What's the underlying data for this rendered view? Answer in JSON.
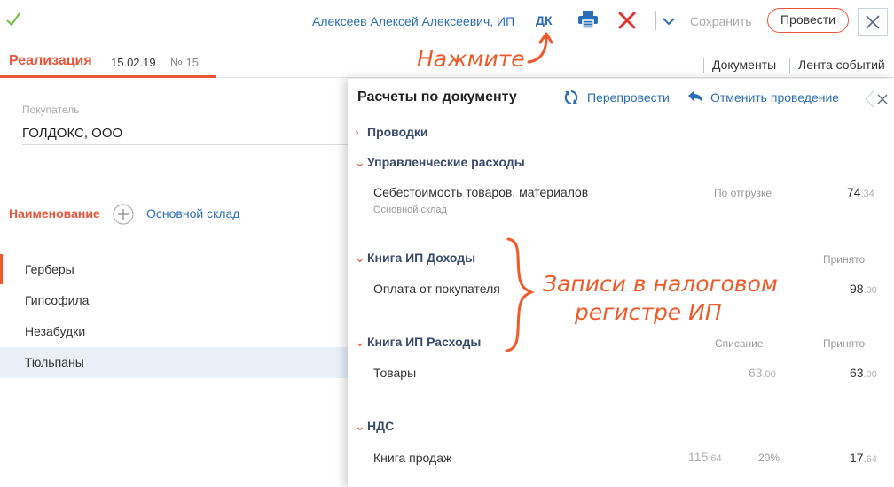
{
  "toolbar": {
    "user": "Алексеев Алексей Алексеевич, ИП",
    "dk": "ДК",
    "save": "Сохранить",
    "post": "Провести"
  },
  "document": {
    "title": "Реализация",
    "date": "15.02.19",
    "number": "№ 15",
    "documents_link": "Документы",
    "events_link": "Лента событий"
  },
  "annotations": {
    "click": "Нажмите",
    "records_line1": "Записи в налоговом",
    "records_line2": "регистре ИП"
  },
  "form": {
    "customer_label": "Покупатель",
    "customer_value": "ГОЛДОКС, ООО",
    "name_header": "Наименование",
    "warehouse": "Основной склад",
    "items": [
      "Герберы",
      "Гипсофила",
      "Незабудки",
      "Тюльпаны"
    ]
  },
  "panel": {
    "title": "Расчеты по документу",
    "repost": "Перепровести",
    "cancel_post": "Отменить проведение",
    "sections": {
      "postings": "Проводки",
      "mgmt": {
        "title": "Управленческие расходы",
        "item": "Себестоимость товаров, материалов",
        "sub": "Основной склад",
        "method": "По отгрузке",
        "amount_int": "74",
        "amount_dec": ".34"
      },
      "income": {
        "title": "Книга ИП Доходы",
        "col_accepted": "Принято",
        "item": "Оплата от покупателя",
        "amount_int": "98",
        "amount_dec": ".00"
      },
      "expenses": {
        "title": "Книга ИП Расходы",
        "col_writeoff": "Списание",
        "col_accepted": "Принято",
        "item": "Товары",
        "writeoff_int": "63",
        "writeoff_dec": ".00",
        "amount_int": "63",
        "amount_dec": ".00"
      },
      "vat": {
        "title": "НДС",
        "item": "Книга продаж",
        "base_int": "115",
        "base_dec": ".64",
        "rate": "20%",
        "amount_int": "17",
        "amount_dec": ".64"
      }
    }
  },
  "colors": {
    "accent": "#e8553a",
    "link": "#2a6eb6",
    "annotation": "#f05a28"
  }
}
